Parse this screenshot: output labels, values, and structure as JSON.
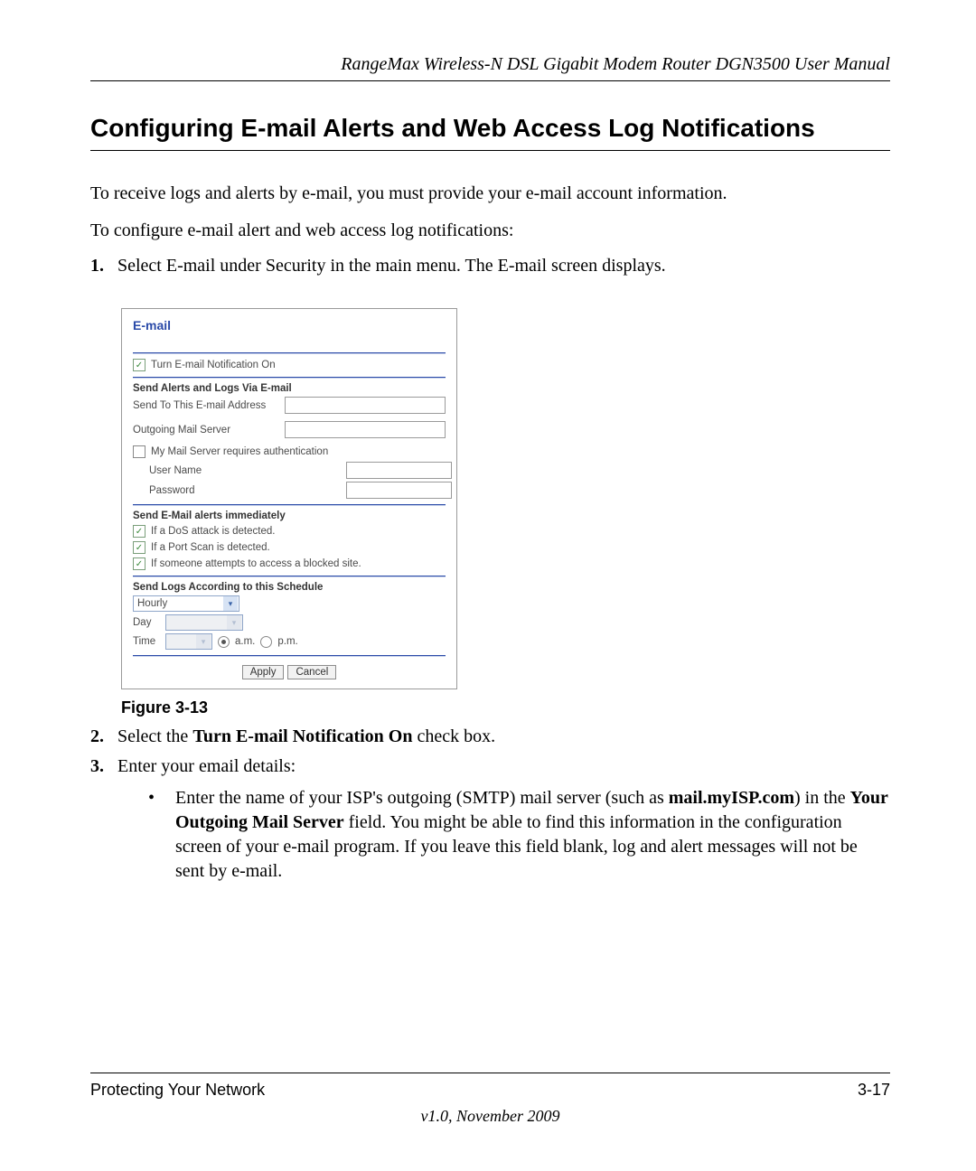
{
  "header": {
    "running_head": "RangeMax Wireless-N DSL Gigabit Modem Router DGN3500 User Manual"
  },
  "title": "Configuring E-mail Alerts and Web Access Log Notifications",
  "paragraphs": {
    "p1": "To receive logs and alerts by e-mail, you must provide your e-mail account information.",
    "p2": "To configure e-mail alert and web access log notifications:"
  },
  "steps": {
    "s1_num": "1.",
    "s1_text": "Select E-mail under Security in the main menu. The E-mail screen displays.",
    "s2_num": "2.",
    "s2_pre": "Select the ",
    "s2_bold": "Turn E-mail Notification On",
    "s2_post": " check box.",
    "s3_num": "3.",
    "s3_text": "Enter your email details:"
  },
  "bullet": {
    "dot": "•",
    "pre": "Enter the name of your ISP's outgoing (SMTP) mail server (such as ",
    "bold1": "mail.myISP.com",
    "mid1": ") in the ",
    "bold2": "Your Outgoing Mail Server",
    "post": " field. You might be able to find this information in the configuration screen of your e-mail program. If you leave this field blank, log and alert messages will not be sent by e-mail."
  },
  "figure_caption": "Figure 3-13",
  "footer": {
    "left": "Protecting Your Network",
    "right": "3-17",
    "version": "v1.0, November 2009"
  },
  "router": {
    "title": "E-mail",
    "check_mark": "✓",
    "turn_on_label": "Turn E-mail Notification On",
    "section_send_alerts": "Send Alerts and Logs Via E-mail",
    "email_addr_label": "Send To This E-mail Address",
    "outgoing_label": "Outgoing Mail Server",
    "auth_label": "My Mail Server requires authentication",
    "username_label": "User Name",
    "password_label": "Password",
    "section_immediate": "Send E-Mail alerts immediately",
    "alert_dos": "If a DoS attack is detected.",
    "alert_portscan": "If a Port Scan is detected.",
    "alert_blocked": "If someone attempts to access a blocked site.",
    "section_schedule": "Send Logs According to this Schedule",
    "schedule_value": "Hourly",
    "day_label": "Day",
    "time_label": "Time",
    "am_label": "a.m.",
    "pm_label": "p.m.",
    "apply_label": "Apply",
    "cancel_label": "Cancel"
  }
}
